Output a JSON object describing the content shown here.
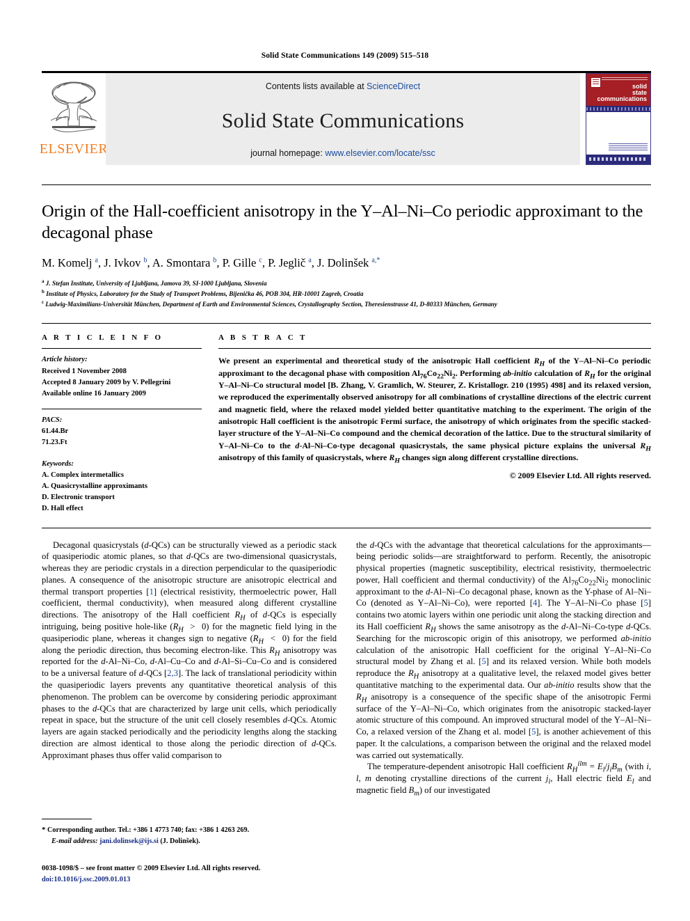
{
  "running_head": "Solid State Communications 149 (2009) 515–518",
  "masthead": {
    "publisher_name": "ELSEVIER",
    "contents_prefix": "Contents lists available at ",
    "contents_link": "ScienceDirect",
    "journal_title": "Solid State Communications",
    "homepage_prefix": "journal homepage: ",
    "homepage_url": "www.elsevier.com/locate/ssc",
    "cover": {
      "line1": "solid",
      "line2": "state",
      "line3": "communications"
    },
    "colors": {
      "link": "#1a4ba0",
      "elsevier_orange": "#F47C20",
      "band_gray": "#ececec",
      "cover_red": "#a51f24",
      "cover_navy": "#2b2b7a"
    }
  },
  "article": {
    "title": "Origin of the Hall-coefficient anisotropy in the Y–Al–Ni–Co periodic approximant to the decagonal phase",
    "authors_html": "M. Komelj <sup>a</sup>, J. Ivkov <sup>b</sup>, A. Smontara <sup>b</sup>, P. Gille <sup>c</sup>, P. Jeglič <sup>a</sup>, J. Dolinšek <sup>a,*</sup>",
    "affiliations": [
      "J. Stefan Institute, University of Ljubljana, Jamova 39, SI-1000 Ljubljana, Slovenia",
      "Institute of Physics, Laboratory for the Study of Transport Problems, Bijenička 46, POB 304, HR-10001 Zagreb, Croatia",
      "Ludwig-Maximilians-Universität München, Department of Earth and Environmental Sciences, Crystallography Section, Theresienstrasse 41, D-80333 München, Germany"
    ],
    "affiliation_marks": [
      "a",
      "b",
      "c"
    ]
  },
  "article_info": {
    "heading": "A R T I C L E   I N F O",
    "history_label": "Article history:",
    "history": [
      "Received 1 November 2008",
      "Accepted 8 January 2009 by V. Pellegrini",
      "Available online 16 January 2009"
    ],
    "pacs_label": "PACS:",
    "pacs": [
      "61.44.Br",
      "71.23.Ft"
    ],
    "keywords_label": "Keywords:",
    "keywords": [
      "A. Complex intermetallics",
      "A. Quasicrystalline approximants",
      "D. Electronic transport",
      "D. Hall effect"
    ]
  },
  "abstract": {
    "heading": "A B S T R A C T",
    "text_html": "We present an experimental and theoretical study of the anisotropic Hall coefficient <i>R<sub>H</sub></i> of the Y&ndash;Al&ndash;Ni&ndash;Co periodic approximant to the decagonal phase with composition Al<sub>76</sub>Co<sub>22</sub>Ni<sub>2</sub>. Performing <i>ab-initio</i> calculation of <i>R<sub>H</sub></i> for the original Y&ndash;Al&ndash;Ni&ndash;Co structural model [B. Zhang, V. Gramlich, W. Steurer, Z. Kristallogr. 210 (1995) 498] and its relaxed version, we reproduced the experimentally observed anisotropy for all combinations of crystalline directions of the electric current and magnetic field, where the relaxed model yielded better quantitative matching to the experiment. The origin of the anisotropic Hall coefficient is the anisotropic Fermi surface, the anisotropy of which originates from the specific stacked-layer structure of the Y&ndash;Al&ndash;Ni&ndash;Co compound and the chemical decoration of the lattice. Due to the structural similarity of Y&ndash;Al&ndash;Ni&ndash;Co to the <i>d</i>-Al&ndash;Ni&ndash;Co-type decagonal quasicrystals, the same physical picture explains the universal <i>R<sub>H</sub></i> anisotropy of this family of quasicrystals, where <i>R<sub>H</sub></i> changes sign along different crystalline directions.",
    "copyright": "© 2009 Elsevier Ltd. All rights reserved."
  },
  "body": {
    "left_html": "Decagonal quasicrystals (<i>d</i>-QCs) can be structurally viewed as a periodic stack of quasiperiodic atomic planes, so that <i>d</i>-QCs are two-dimensional quasicrystals, whereas they are periodic crystals in a direction perpendicular to the quasiperiodic planes. A consequence of the anisotropic structure are anisotropic electrical and thermal transport properties [<span class='ref'>1</span>] (electrical resistivity, thermoelectric power, Hall coefficient, thermal conductivity), when measured along different crystalline directions. The anisotropy of the Hall coefficient <i>R<sub>H</sub></i> of <i>d</i>-QCs is especially intriguing, being positive hole-like (<i>R<sub>H</sub></i> &nbsp;&gt; &nbsp;0) for the magnetic field lying in the quasiperiodic plane, whereas it changes sign to negative (<i>R<sub>H</sub></i> &nbsp;&lt; &nbsp;0) for the field along the periodic direction, thus becoming electron-like. This <i>R<sub>H</sub></i> anisotropy was reported for the <i>d</i>-Al&ndash;Ni&ndash;Co, <i>d</i>-Al&ndash;Cu&ndash;Co and <i>d</i>-Al&ndash;Si&ndash;Cu&ndash;Co and is considered to be a universal feature of <i>d</i>-QCs [<span class='ref'>2,3</span>]. The lack of translational periodicity within the quasiperiodic layers prevents any quantitative theoretical analysis of this phenomenon. The problem can be overcome by considering periodic approximant phases to the <i>d</i>-QCs that are characterized by large unit cells, which periodically repeat in space, but the structure of the unit cell closely resembles <i>d</i>-QCs. Atomic layers are again stacked periodically and the periodicity lengths along the stacking direction are almost identical to those along the periodic direction of <i>d</i>-QCs. Approximant phases thus offer valid comparison to",
    "right_p1_html": "the <i>d</i>-QCs with the advantage that theoretical calculations for the approximants&mdash;being periodic solids&mdash;are straightforward to perform. Recently, the anisotropic physical properties (magnetic susceptibility, electrical resistivity, thermoelectric power, Hall coefficient and thermal conductivity) of the Al<sub>76</sub>Co<sub>22</sub>Ni<sub>2</sub> monoclinic approximant to the <i>d</i>-Al&ndash;Ni&ndash;Co decagonal phase, known as the Y-phase of Al&ndash;Ni&ndash;Co (denoted as Y&ndash;Al&ndash;Ni&ndash;Co), were reported [<span class='ref'>4</span>]. The Y&ndash;Al&ndash;Ni&ndash;Co phase [<span class='ref'>5</span>] contains two atomic layers within one periodic unit along the stacking direction and its Hall coefficient <i>R<sub>H</sub></i> shows the same anisotropy as the <i>d</i>-Al&ndash;Ni&ndash;Co-type <i>d</i>-QCs. Searching for the microscopic origin of this anisotropy, we performed <i>ab-initio</i> calculation of the anisotropic Hall coefficient for the original Y&ndash;Al&ndash;Ni&ndash;Co structural model by Zhang et al. [<span class='ref'>5</span>] and its relaxed version. While both models reproduce the <i>R<sub>H</sub></i> anisotropy at a qualitative level, the relaxed model gives better quantitative matching to the experimental data. Our <i>ab-initio</i> results show that the <i>R<sub>H</sub></i> anisotropy is a consequence of the specific shape of the anisotropic Fermi surface of the Y&ndash;Al&ndash;Ni&ndash;Co, which originates from the anisotropic stacked-layer atomic structure of this compound. An improved structural model of the Y&ndash;Al&ndash;Ni&ndash;Co, a relaxed version of the Zhang et al. model [<span class='ref'>5</span>], is another achievement of this paper. It the calculations, a comparison between the original and the relaxed model was carried out systematically.",
    "right_p2_html": "The temperature-dependent anisotropic Hall coefficient <i>R<sub>H</sub><sup>ilm</sup></i> = <i>E<sub>l</sub></i>/<i>j<sub>i</sub>B<sub>m</sub></i> (with <i>i</i>, <i>l</i>, <i>m</i> denoting crystalline directions of the current <i>j<sub>i</sub></i>, Hall electric field <i>E<sub>l</sub></i> and magnetic field <i>B<sub>m</sub></i>) of our investigated"
  },
  "footnote": {
    "star": "*",
    "text_html": "Corresponding author. Tel.: +386 1 4773 740; fax: +386 1 4263 269.",
    "email_label": "E-mail address:",
    "email": "jani.dolinsek@ijs.si",
    "email_owner": "(J. Dolinšek)."
  },
  "imprint": {
    "line1": "0038-1098/$ – see front matter © 2009 Elsevier Ltd. All rights reserved.",
    "doi": "doi:10.1016/j.ssc.2009.01.013"
  }
}
